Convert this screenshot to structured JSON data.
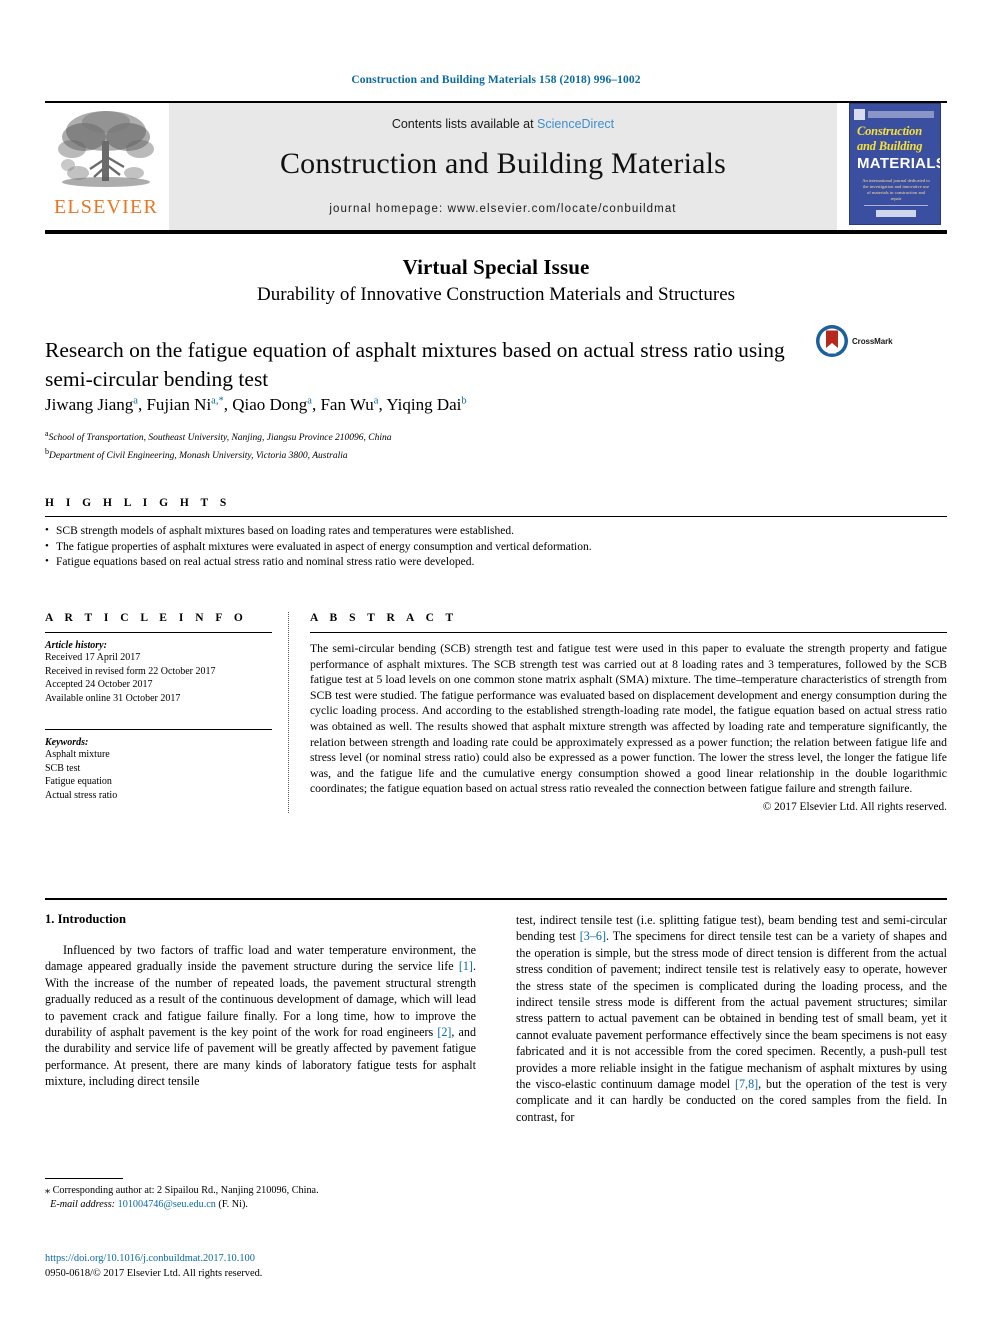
{
  "running_head": "Construction and Building Materials 158 (2018) 996–1002",
  "masthead": {
    "contents_prefix": "Contents lists available at ",
    "sciencedirect": "ScienceDirect",
    "journal_title": "Construction and Building Materials",
    "homepage": "journal homepage: www.elsevier.com/locate/conbuildmat",
    "publisher": "ELSEVIER",
    "cover": {
      "line1": "Construction",
      "line2": "and Building",
      "line3": "MATERIALS",
      "subtitle": "An international journal dedicated to the investigation and innovative use of materials in construction and repair"
    }
  },
  "vsi": {
    "title": "Virtual Special Issue",
    "subtitle": "Durability of Innovative Construction Materials and Structures"
  },
  "article": {
    "title": "Research on the fatigue equation of asphalt mixtures based on actual stress ratio using semi-circular bending test",
    "crossmark_label": "CrossMark",
    "authors": [
      {
        "name": "Jiwang Jiang",
        "sup": "a"
      },
      {
        "name": "Fujian Ni",
        "sup": "a,*"
      },
      {
        "name": "Qiao Dong",
        "sup": "a"
      },
      {
        "name": "Fan Wu",
        "sup": "a"
      },
      {
        "name": "Yiqing Dai",
        "sup": "b"
      }
    ],
    "affiliations": [
      {
        "sup": "a",
        "text": "School of Transportation, Southeast University, Nanjing, Jiangsu Province 210096, China"
      },
      {
        "sup": "b",
        "text": "Department of Civil Engineering, Monash University, Victoria 3800, Australia"
      }
    ]
  },
  "highlights": {
    "heading": "H I G H L I G H T S",
    "items": [
      "SCB strength models of asphalt mixtures based on loading rates and temperatures were established.",
      "The fatigue properties of asphalt mixtures were evaluated in aspect of energy consumption and vertical deformation.",
      "Fatigue equations based on real actual stress ratio and nominal stress ratio were developed."
    ]
  },
  "article_info": {
    "heading": "A R T I C L E   I N F O",
    "history_label": "Article history:",
    "history": [
      "Received 17 April 2017",
      "Received in revised form 22 October 2017",
      "Accepted 24 October 2017",
      "Available online 31 October 2017"
    ],
    "keywords_label": "Keywords:",
    "keywords": [
      "Asphalt mixture",
      "SCB test",
      "Fatigue equation",
      "Actual stress ratio"
    ]
  },
  "abstract": {
    "heading": "A B S T R A C T",
    "text": "The semi-circular bending (SCB) strength test and fatigue test were used in this paper to evaluate the strength property and fatigue performance of asphalt mixtures. The SCB strength test was carried out at 8 loading rates and 3 temperatures, followed by the SCB fatigue test at 5 load levels on one common stone matrix asphalt (SMA) mixture. The time–temperature characteristics of strength from SCB test were studied. The fatigue performance was evaluated based on displacement development and energy consumption during the cyclic loading process. And according to the established strength-loading rate model, the fatigue equation based on actual stress ratio was obtained as well. The results showed that asphalt mixture strength was affected by loading rate and temperature significantly, the relation between strength and loading rate could be approximately expressed as a power function; the relation between fatigue life and stress level (or nominal stress ratio) could also be expressed as a power function. The lower the stress level, the longer the fatigue life was, and the fatigue life and the cumulative energy consumption showed a good linear relationship in the double logarithmic coordinates; the fatigue equation based on actual stress ratio revealed the connection between fatigue failure and strength failure.",
    "copyright": "© 2017 Elsevier Ltd. All rights reserved."
  },
  "body": {
    "section_heading": "1. Introduction",
    "left_para_1a": "Influenced by two factors of traffic load and water temperature environment, the damage appeared gradually inside the pavement structure during the service life ",
    "left_ref_1": "[1]",
    "left_para_1b": ". With the increase of the number of repeated loads, the pavement structural strength gradually reduced as a result of the continuous development of damage, which will lead to pavement crack and fatigue failure finally. For a long time, how to improve the durability of asphalt pavement is the key point of the work for road engineers ",
    "left_ref_2": "[2]",
    "left_para_1c": ", and the durability and service life of pavement will be greatly affected by pavement fatigue performance. At present, there are many kinds of laboratory fatigue tests for asphalt mixture, including direct tensile",
    "right_para_a": "test, indirect tensile test (i.e. splitting fatigue test), beam bending test and semi-circular bending test ",
    "right_ref_1": "[3–6]",
    "right_para_b": ". The specimens for direct tensile test can be a variety of shapes and the operation is simple, but the stress mode of direct tension is different from the actual stress condition of pavement; indirect tensile test is relatively easy to operate, however the stress state of the specimen is complicated during the loading process, and the indirect tensile stress mode is different from the actual pavement structures; similar stress pattern to actual pavement can be obtained in bending test of small beam, yet it cannot evaluate pavement performance effectively since the beam specimens is not easy fabricated and it is not accessible from the cored specimen. Recently, a push-pull test provides a more reliable insight in the fatigue mechanism of asphalt mixtures by using the visco-elastic continuum damage model ",
    "right_ref_2": "[7,8]",
    "right_para_c": ", but the operation of the test is very complicate and it can hardly be conducted on the cored samples from the field. In contrast, for"
  },
  "footnote": {
    "corresponding": "⁎ Corresponding author at: 2 Sipailou Rd., Nanjing 210096, China.",
    "email_label": "E-mail address:",
    "email": "101004746@seu.edu.cn",
    "email_suffix": "(F. Ni)."
  },
  "colophon": {
    "doi": "https://doi.org/10.1016/j.conbuildmat.2017.10.100",
    "issn_line": "0950-0618/© 2017 Elsevier Ltd. All rights reserved."
  },
  "colors": {
    "link": "#0b6aa2",
    "sciencedirect": "#3f8fcb",
    "elsevier_orange": "#e87722",
    "banner_bg": "#e8e8e8",
    "cover_blue": "#3b4fa0"
  }
}
